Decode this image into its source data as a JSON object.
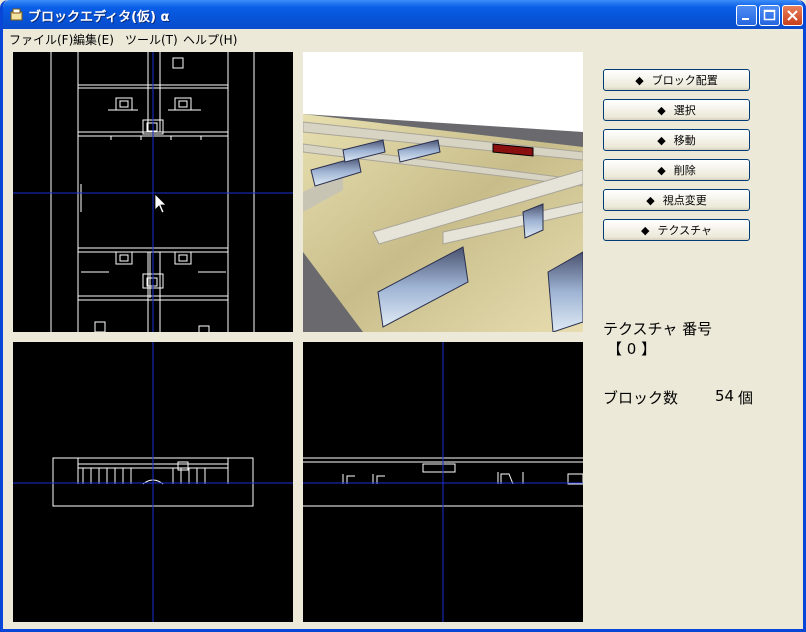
{
  "window": {
    "title": "ブロックエディタ(仮) α"
  },
  "menu": [
    "ファイル(F)",
    "編集(E)",
    "ツール(T)",
    "ヘルプ(H)"
  ],
  "buttons": [
    {
      "label": "ブロック配置"
    },
    {
      "label": "選択"
    },
    {
      "label": "移動"
    },
    {
      "label": "削除"
    },
    {
      "label": "視点変更"
    },
    {
      "label": "テクスチャ"
    }
  ],
  "button_marker": "◆",
  "texture": {
    "label": "テクスチャ 番号",
    "value": "【 0 】"
  },
  "blocks": {
    "label": "ブロック数",
    "count": "54",
    "unit": "個"
  },
  "colors": {
    "accent_blue": "#0a4ccc",
    "crosshair": "#1a2fd0",
    "wire": "#ffffff",
    "viewport_bg": "#000000"
  }
}
